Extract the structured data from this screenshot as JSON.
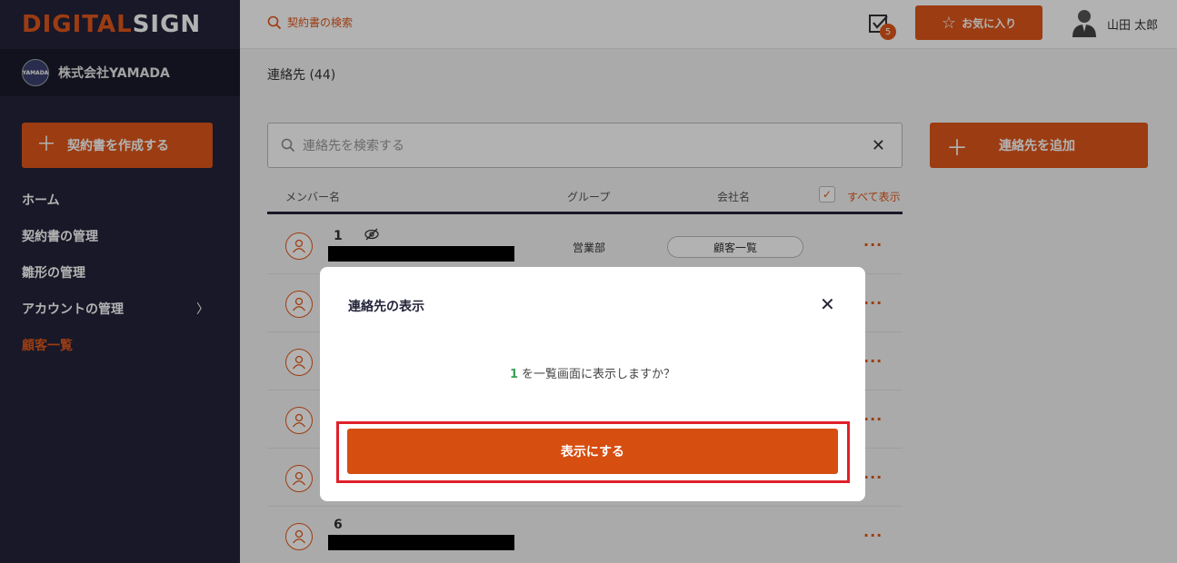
{
  "logo": {
    "part1": "DIGITAL",
    "part2": "SIGN"
  },
  "company": {
    "badge": "YAMADA",
    "name": "株式会社YAMADA"
  },
  "sidebar": {
    "create_label": "契約書を作成する",
    "items": [
      {
        "label": "ホーム"
      },
      {
        "label": "契約書の管理"
      },
      {
        "label": "雛形の管理"
      },
      {
        "label": "アカウントの管理"
      },
      {
        "label": "顧客一覧"
      }
    ]
  },
  "header": {
    "search_placeholder": "契約書の検索",
    "task_count": "5",
    "favorite_label": "お気に入り",
    "user_name": "山田 太郎"
  },
  "main": {
    "breadcrumb": "連絡先 (44)",
    "search_placeholder": "連絡先を検索する",
    "add_label": "連絡先を追加",
    "columns": {
      "member": "メンバー名",
      "group": "グループ",
      "company": "会社名",
      "show_all": "すべて表示"
    },
    "rows": [
      {
        "num": "1",
        "group": "営業部",
        "company": "顧客一覧"
      },
      {
        "num": "",
        "group": "",
        "company": ""
      },
      {
        "num": "",
        "group": "",
        "company": ""
      },
      {
        "num": "",
        "group": "",
        "company": ""
      },
      {
        "num": "",
        "group": "",
        "company": ""
      },
      {
        "num": "6",
        "group": "",
        "company": ""
      }
    ]
  },
  "modal": {
    "title": "連絡先の表示",
    "highlight": "1",
    "message": "を一覧画面に表示しますか？",
    "confirm_label": "表示にする"
  }
}
